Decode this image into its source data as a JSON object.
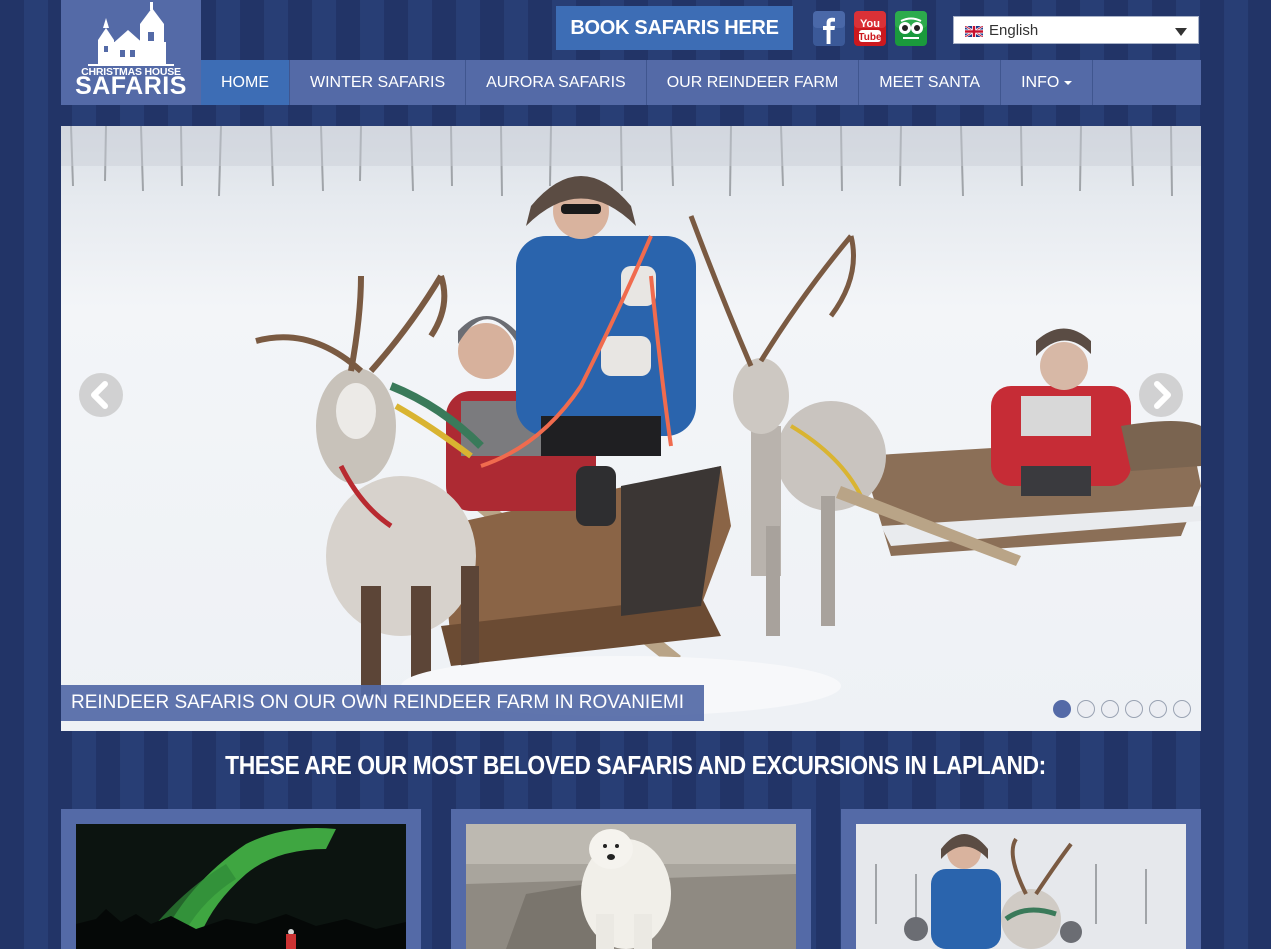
{
  "brand": {
    "line1": "CHRISTMAS HOUSE",
    "line2": "SAFARIS"
  },
  "header": {
    "book_label": "BOOK SAFARIS HERE",
    "social": [
      {
        "name": "facebook-icon",
        "color": "#3b5998"
      },
      {
        "name": "youtube-icon",
        "color": "#cc181e",
        "text1": "You",
        "text2": "Tube"
      },
      {
        "name": "tripadvisor-icon",
        "color": "#1a9a3c"
      }
    ],
    "language": {
      "selected": "English",
      "flag": "uk-flag-icon"
    }
  },
  "nav": {
    "items": [
      {
        "label": "HOME",
        "active": true
      },
      {
        "label": "WINTER SAFARIS",
        "active": false
      },
      {
        "label": "AURORA SAFARIS",
        "active": false
      },
      {
        "label": "OUR REINDEER FARM",
        "active": false
      },
      {
        "label": "MEET SANTA",
        "active": false
      },
      {
        "label": "INFO",
        "active": false,
        "dropdown": true
      }
    ]
  },
  "slider": {
    "caption": "REINDEER SAFARIS ON OUR OWN REINDEER FARM IN ROVANIEMI",
    "slide_count": 6,
    "active_slide": 1,
    "image": "reindeer-sleigh-ride-photo"
  },
  "section": {
    "title": "THESE ARE OUR MOST BELOVED SAFARIS AND EXCURSIONS IN LAPLAND:",
    "cards": [
      {
        "image": "aurora-borealis-photo"
      },
      {
        "image": "polar-bear-photo"
      },
      {
        "image": "reindeer-safari-photo"
      }
    ]
  },
  "colors": {
    "background": "#24386d",
    "nav": "#546aa7",
    "accent": "#3d6db5"
  }
}
